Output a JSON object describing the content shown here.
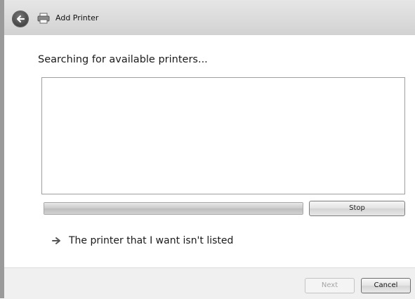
{
  "window": {
    "title": "Add Printer",
    "back_icon": "back-arrow-icon",
    "title_icon": "printer-icon"
  },
  "main": {
    "heading": "Searching for available printers...",
    "results": [],
    "search_progress_percent": 100,
    "stop_label": "Stop",
    "not_listed_link": "The printer that I want isn't listed",
    "not_listed_icon": "arrow-right-icon"
  },
  "footer": {
    "next_label": "Next",
    "next_enabled": false,
    "cancel_label": "Cancel"
  }
}
